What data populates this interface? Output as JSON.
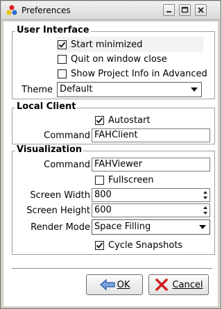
{
  "window": {
    "title": "Preferences"
  },
  "user_interface": {
    "group_title": "User Interface",
    "start_minimized": {
      "label": "Start minimized",
      "checked": true
    },
    "quit_on_close": {
      "label": "Quit on window close",
      "checked": false
    },
    "show_project_info": {
      "label": "Show Project Info in Advanced",
      "checked": false
    },
    "theme": {
      "label": "Theme",
      "value": "Default"
    }
  },
  "local_client": {
    "group_title": "Local Client",
    "autostart": {
      "label": "Autostart",
      "checked": true
    },
    "command": {
      "label": "Command",
      "value": "FAHClient"
    }
  },
  "visualization": {
    "group_title": "Visualization",
    "command": {
      "label": "Command",
      "value": "FAHViewer"
    },
    "fullscreen": {
      "label": "Fullscreen",
      "checked": false
    },
    "screen_width": {
      "label": "Screen Width",
      "value": "800"
    },
    "screen_height": {
      "label": "Screen Height",
      "value": "600"
    },
    "render_mode": {
      "label": "Render Mode",
      "value": "Space Filling"
    },
    "cycle_snapshots": {
      "label": "Cycle Snapshots",
      "checked": true
    }
  },
  "buttons": {
    "ok": "OK",
    "cancel": "Cancel"
  },
  "colors": {
    "cancel_icon": "#d02020",
    "ok_icon": "#4a7cc9"
  }
}
